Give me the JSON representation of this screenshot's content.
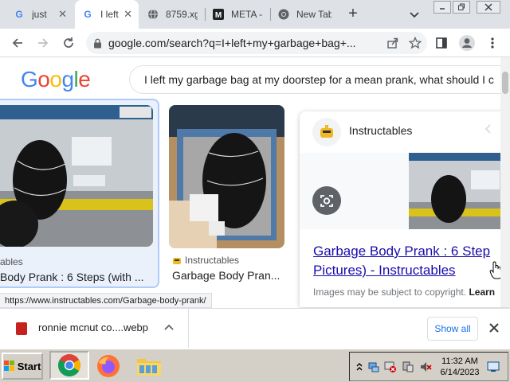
{
  "tabs": [
    {
      "label": "just",
      "icon": "google-icon",
      "active": false
    },
    {
      "label": "I left",
      "icon": "google-icon",
      "active": true
    },
    {
      "label": "8759.xg",
      "icon": "globe-icon",
      "active": false
    },
    {
      "label": "META - H",
      "icon": "meta-icon",
      "active": false
    },
    {
      "label": "New Tab",
      "icon": "chrome-icon",
      "active": false
    }
  ],
  "tab_close_glyph": "✕",
  "new_tab_glyph": "+",
  "omnibox": {
    "url": "google.com/search?q=I+left+my+garbage+bag+..."
  },
  "search": {
    "logo": [
      "G",
      "o",
      "o",
      "g",
      "l",
      "e"
    ],
    "logo_colors": [
      "#4285f4",
      "#ea4335",
      "#fbbc05",
      "#4285f4",
      "#34a853",
      "#ea4335"
    ],
    "query": "I left my garbage bag at my doorstep for a mean prank, what should I c"
  },
  "results": [
    {
      "source": "ables",
      "title": "Body Prank : 6 Steps (with ..."
    },
    {
      "source": "Instructables",
      "title": "Garbage Body Pran..."
    }
  ],
  "panel": {
    "source": "Instructables",
    "title_line1": "Garbage Body Prank : 6 Step",
    "title_line2": "Pictures) - Instructables",
    "copyright": "Images may be subject to copyright.",
    "learn": "Learn"
  },
  "status_url": "https://www.instructables.com/Garbage-body-prank/",
  "download": {
    "filename": "ronnie mcnut co....webp",
    "show_all": "Show all"
  },
  "taskbar": {
    "start": "Start",
    "time": "11:32 AM",
    "date": "6/14/2023"
  },
  "colors": {
    "accent": "#1a73e8",
    "link": "#1a0dab",
    "tab_strip": "#dee1e6",
    "taskbar": "#d4d0c8"
  }
}
